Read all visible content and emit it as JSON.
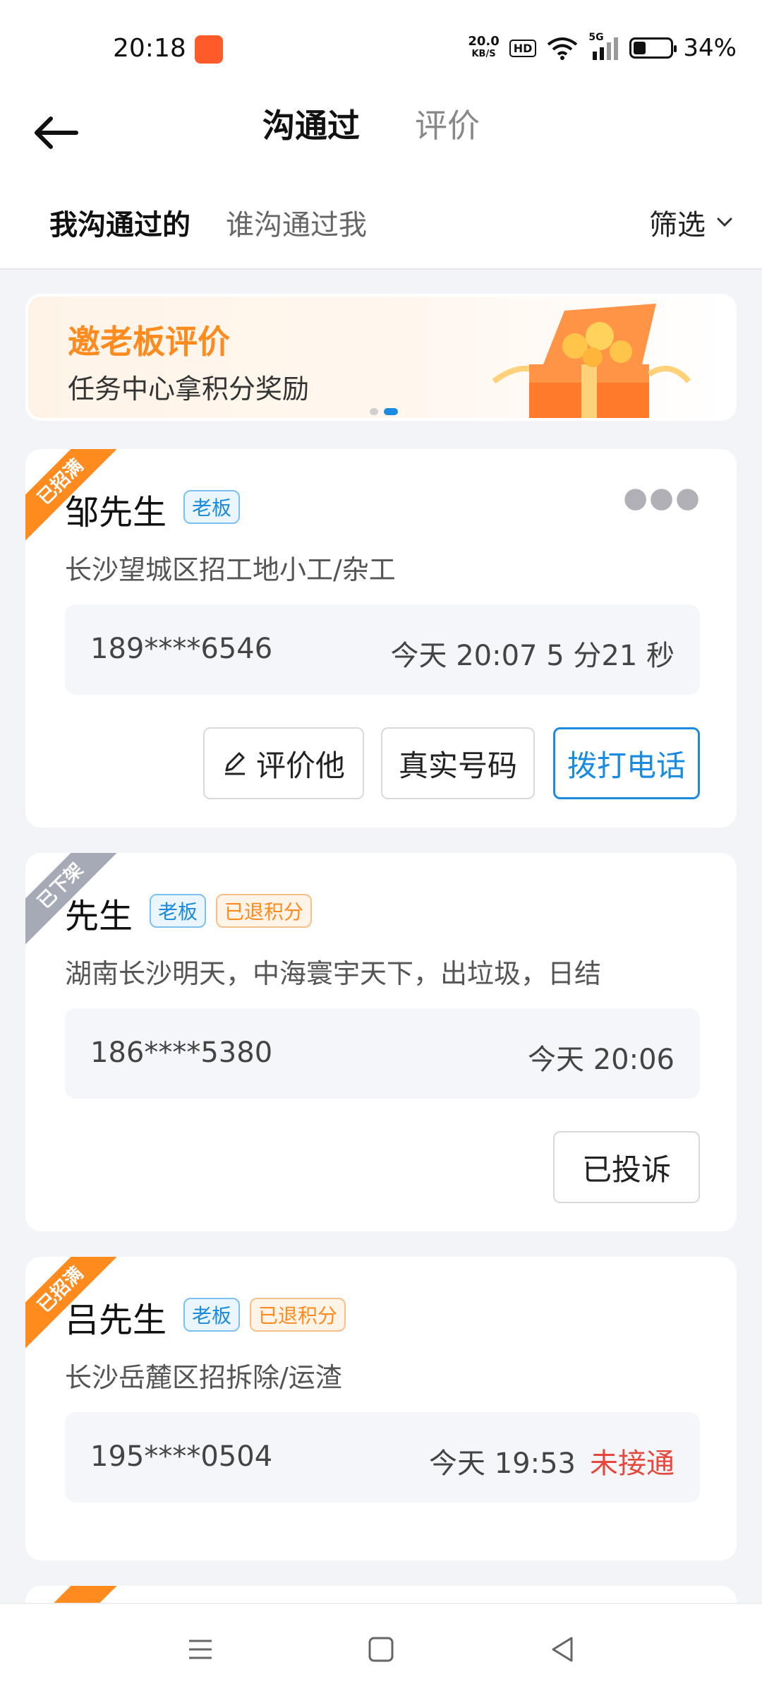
{
  "status_bar": {
    "time": "20:18",
    "net_speed_value": "20.0",
    "net_speed_unit": "KB/S",
    "hd_label": "HD",
    "network_label": "5G",
    "battery_percent": "34%",
    "battery_level": 0.34
  },
  "header": {
    "tabs": [
      {
        "label": "沟通过",
        "active": true
      },
      {
        "label": "评价",
        "active": false
      }
    ]
  },
  "subtabs": {
    "items": [
      {
        "label": "我沟通过的",
        "active": true
      },
      {
        "label": "谁沟通过我",
        "active": false
      }
    ],
    "filter_label": "筛选"
  },
  "banner": {
    "title": "邀老板评价",
    "subtitle": "任务中心拿积分奖励",
    "page_index": 2,
    "page_count": 2
  },
  "cards": [
    {
      "ribbon": "已招满",
      "name": "邹先生",
      "tags": [
        "老板"
      ],
      "description": "长沙望城区招工地小工/杂工",
      "phone": "189****6546",
      "time": "今天 20:07  5 分21 秒",
      "buttons": {
        "rate": "评价他",
        "real_number": "真实号码",
        "call": "拨打电话"
      }
    },
    {
      "ribbon": "已下架",
      "name": "先生",
      "tags": [
        "老板",
        "已退积分"
      ],
      "description": "湖南长沙明天，中海寰宇天下，出垃圾，日结",
      "phone": "186****5380",
      "time": "今天 20:06",
      "buttons": {
        "complained": "已投诉"
      }
    },
    {
      "ribbon": "已招满",
      "name": "吕先生",
      "tags": [
        "老板",
        "已退积分"
      ],
      "description": "长沙岳麓区招拆除/运渣",
      "phone": "195****0504",
      "time": "今天 19:53",
      "call_status": "未接通"
    }
  ],
  "colors": {
    "accent": "#1a8be0",
    "orange": "#ff8a1e",
    "missed": "#e5483c",
    "ribbon_gray": "#a6a9b6"
  }
}
